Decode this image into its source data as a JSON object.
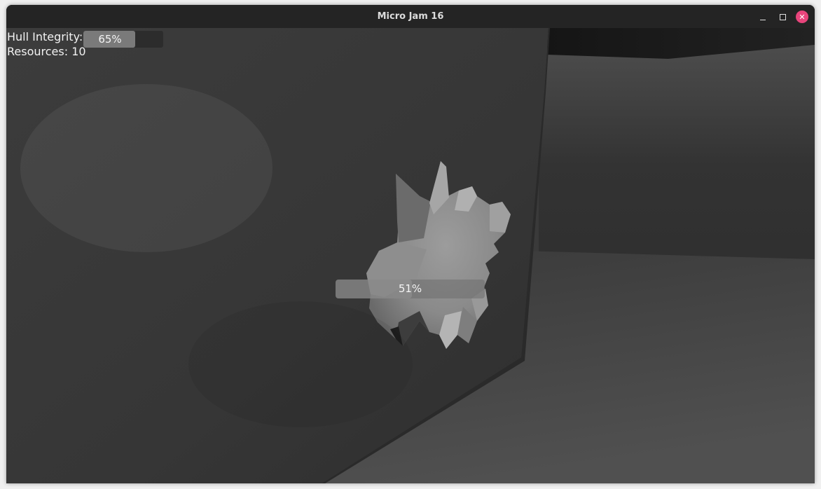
{
  "window": {
    "title": "Micro Jam 16",
    "controls": [
      "minimize-icon",
      "maximize-icon",
      "close-icon"
    ],
    "close_color": "#e8457c"
  },
  "hud": {
    "hull_label": "Hull Integrity:",
    "hull_value": 0.65,
    "hull_text": "65%",
    "resources_text": "Resources: 10"
  },
  "mining": {
    "progress_value": 0.51,
    "progress_text": "51%"
  }
}
